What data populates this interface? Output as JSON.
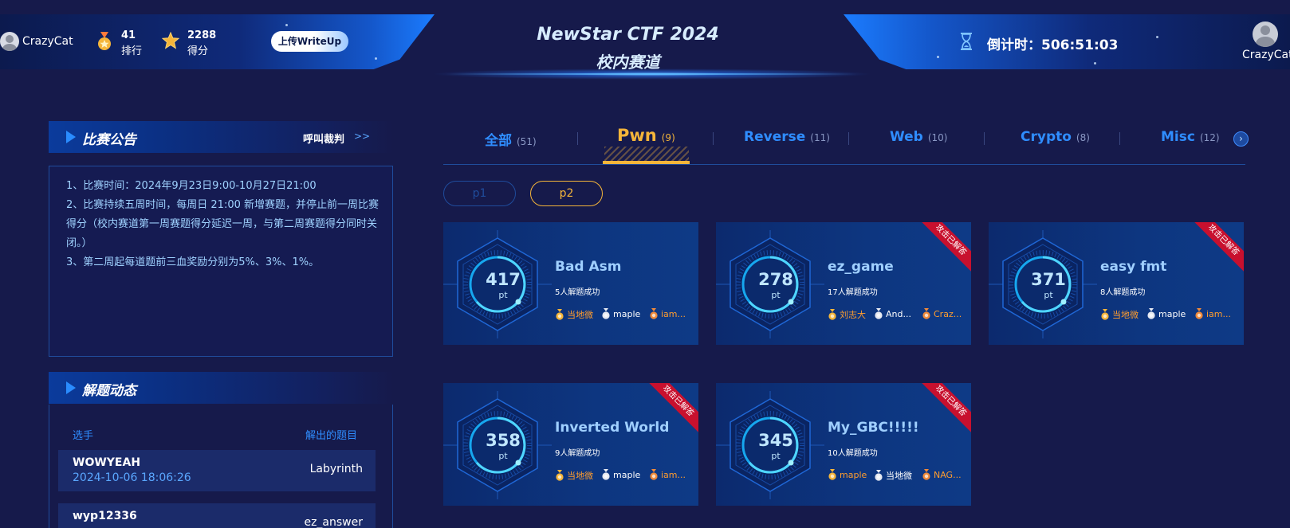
{
  "header": {
    "user_left": "CrazyCat",
    "rank_value": "41",
    "rank_label": "排行",
    "score_value": "2288",
    "score_label": "得分",
    "upload_label": "上传WriteUp",
    "title_line1": "NewStar CTF 2024",
    "title_line2": "校内赛道",
    "countdown": "倒计时：506:51:03",
    "user_right": "CrazyCat"
  },
  "notice": {
    "title": "比赛公告",
    "link": "呼叫裁判",
    "link_arrow": ">>",
    "items": [
      "1、比赛时间：2024年9月23日9:00-10月27日21:00",
      "2、比赛持续五周时间，每周日 21:00 新增赛题，并停止前一周比赛得分（校内赛道第一周赛题得分延迟一周，与第二周赛题得分同时关闭。）",
      "3、第二周起每道题前三血奖励分别为5%、3%、1%。"
    ]
  },
  "solves": {
    "title": "解题动态",
    "col_player": "选手",
    "col_challenge": "解出的题目",
    "rows": [
      {
        "user": "WOWYEAH",
        "time": "2024-10-06 18:06:26",
        "challenge": "Labyrinth"
      },
      {
        "user": "wyp12336",
        "time": "",
        "challenge": "ez_answer"
      }
    ]
  },
  "tabs": [
    {
      "label": "全部",
      "count": "(51)"
    },
    {
      "label": "Pwn",
      "count": "(9)"
    },
    {
      "label": "Reverse",
      "count": "(11)"
    },
    {
      "label": "Web",
      "count": "(10)"
    },
    {
      "label": "Crypto",
      "count": "(8)"
    },
    {
      "label": "Misc",
      "count": "(12)"
    }
  ],
  "tab_next": "›",
  "pages": [
    "p1",
    "p2"
  ],
  "ribbon_text": "攻击已解答",
  "pt_label": "pt",
  "cards": [
    {
      "score": "417",
      "name": "Bad Asm",
      "solved": "5人解题成功",
      "ribbon": false,
      "solvers": [
        "当地微",
        "maple",
        "iam..."
      ]
    },
    {
      "score": "278",
      "name": "ez_game",
      "solved": "17人解题成功",
      "ribbon": true,
      "solvers": [
        "刘志大",
        "And...",
        "Craz..."
      ]
    },
    {
      "score": "371",
      "name": "easy fmt",
      "solved": "8人解题成功",
      "ribbon": true,
      "solvers": [
        "当地微",
        "maple",
        "iam..."
      ]
    },
    {
      "score": "358",
      "name": "Inverted World",
      "solved": "9人解题成功",
      "ribbon": true,
      "solvers": [
        "当地微",
        "maple",
        "iam..."
      ]
    },
    {
      "score": "345",
      "name": "My_GBC!!!!!",
      "solved": "10人解题成功",
      "ribbon": true,
      "solvers": [
        "maple",
        "当地微",
        "NAG..."
      ]
    }
  ],
  "colors": {
    "background": "#161a4b",
    "accent_blue": "#2f8dff",
    "active_gold": "#f5b53a",
    "ribbon_red": "#c8102e"
  }
}
